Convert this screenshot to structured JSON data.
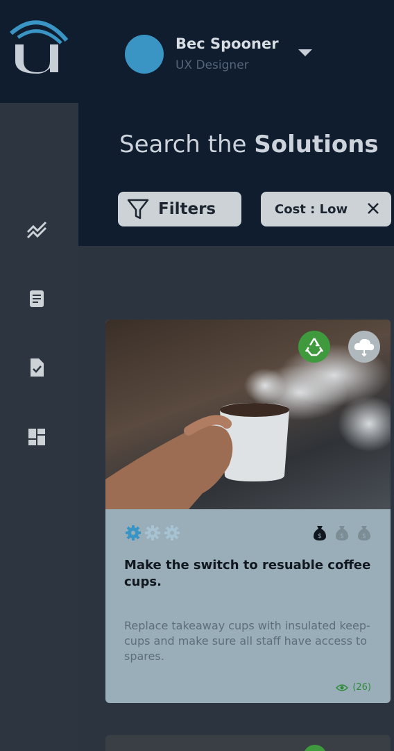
{
  "header": {
    "user_name": "Bec Spooner",
    "user_role": "UX Designer"
  },
  "search": {
    "title_prefix": "Search the ",
    "title_bold": "Solutions"
  },
  "filters": {
    "button_label": "Filters",
    "active_chip": "Cost : Low"
  },
  "card": {
    "title": "Make the switch to resuable coffee cups.",
    "description": "Replace takeaway cups with insulated keep-cups and make sure all staff have access to spares.",
    "views": "(26)",
    "effort_level": 1,
    "effort_max": 3,
    "cost_level": 1,
    "cost_max": 3,
    "badges": [
      "recycle-icon",
      "co2-cloud-icon"
    ]
  },
  "colors": {
    "header_bg": "#0f1d2f",
    "accent_blue": "#3a95c4",
    "recycle_green": "#3f9a3e",
    "card_bg": "#99aeb9"
  }
}
